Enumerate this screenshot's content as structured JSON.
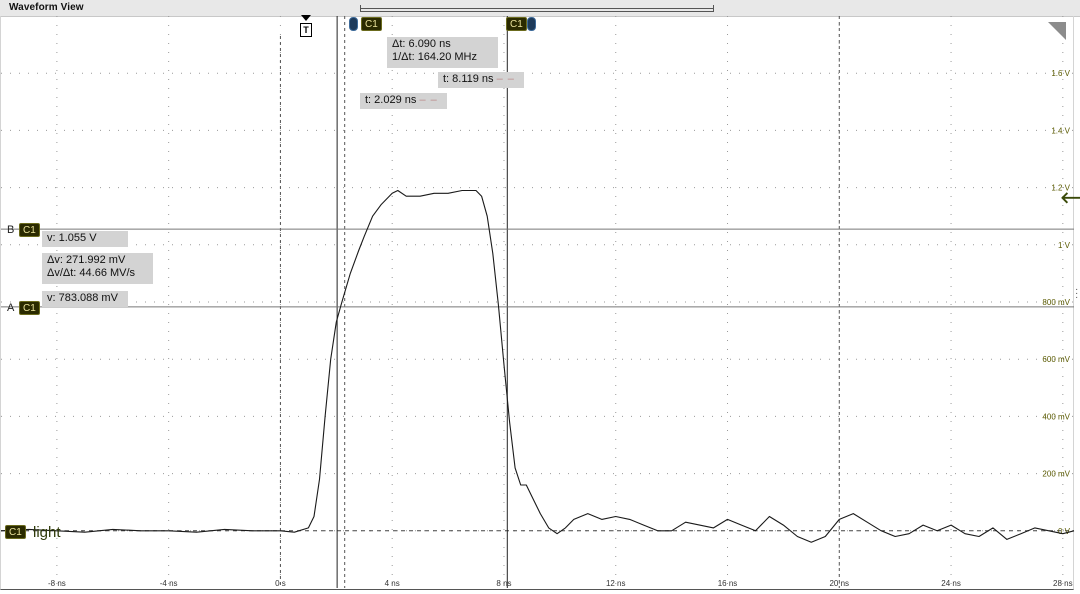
{
  "window": {
    "title": "Waveform View"
  },
  "colors": {
    "trace": "#1a1a1a",
    "grid_dot": "#9a9a9a",
    "cursor_line": "#222222",
    "axis_text": "#333333",
    "volt_text": "#5a5a00",
    "readout_bg": "#d3d3d3"
  },
  "cursors": {
    "a_label": "A",
    "b_label": "B",
    "channel_badge": "C1",
    "readouts": {
      "delta_t": "Δt: 6.090 ns",
      "inv_delta_t": "1/Δt: 164.20 MHz",
      "t_b": "t: 8.119 ns",
      "t_a": "t: 2.029 ns",
      "v_b": "v: 1.055 V",
      "delta_v": "Δv: 271.992 mV",
      "dv_dt": "Δv/Δt: 44.66 MV/s",
      "v_a": "v: 783.088 mV"
    }
  },
  "channel": {
    "badge": "C1",
    "label": "light"
  },
  "trigger": {
    "marker": "T"
  },
  "chart_data": {
    "type": "line",
    "title": "",
    "xlabel": "",
    "ylabel": "",
    "x_unit": "ns",
    "y_unit": "V",
    "xlim": [
      -10,
      28.4
    ],
    "ylim": [
      -0.2,
      1.8
    ],
    "x_ticks": [
      -8,
      -4,
      0,
      4,
      8,
      12,
      16,
      20,
      24,
      28
    ],
    "x_tick_labels": [
      "-8 ns",
      "-4 ns",
      "0 s",
      "4 ns",
      "8 ns",
      "12 ns",
      "16 ns",
      "20 ns",
      "24 ns",
      "28 ns"
    ],
    "y_ticks": [
      0,
      0.2,
      0.4,
      0.6,
      0.8,
      1.0,
      1.2,
      1.4,
      1.6
    ],
    "y_tick_labels": [
      "0 V",
      "200 mV",
      "400 mV",
      "600 mV",
      "800 mV",
      "1 V",
      "1.2 V",
      "1.4 V",
      "1.6 V"
    ],
    "grid": "dotted",
    "cursor_a": {
      "t": 2.029,
      "v": 0.783088
    },
    "cursor_b": {
      "t": 8.119,
      "v": 1.055
    },
    "series": [
      {
        "x": [
          -10,
          -9,
          -8,
          -7,
          -6,
          -5,
          -4,
          -3,
          -2,
          -1,
          0,
          0.5,
          1.0,
          1.2,
          1.4,
          1.6,
          1.8,
          2.0,
          2.2,
          2.5,
          2.8,
          3.0,
          3.3,
          3.6,
          4.0,
          4.2,
          4.5,
          5.0,
          5.5,
          6.0,
          6.5,
          7.0,
          7.2,
          7.4,
          7.6,
          7.8,
          8.0,
          8.2,
          8.4,
          8.6,
          8.8,
          9.0,
          9.3,
          9.6,
          9.9,
          10.2,
          10.5,
          11.0,
          11.5,
          12.0,
          12.5,
          13.0,
          13.5,
          14.0,
          14.5,
          15.0,
          15.5,
          16.0,
          16.5,
          17.0,
          17.5,
          18.0,
          18.5,
          19.0,
          19.5,
          20.0,
          20.5,
          21.0,
          21.5,
          22.0,
          22.5,
          23.0,
          23.5,
          24.0,
          24.5,
          25.0,
          25.5,
          26.0,
          26.5,
          27.0,
          27.5,
          28.0,
          28.4
        ],
        "y": [
          0.0,
          0.005,
          0.0,
          -0.005,
          0.005,
          0.0,
          0.0,
          -0.005,
          0.005,
          0.0,
          0.0,
          -0.005,
          0.01,
          0.05,
          0.18,
          0.4,
          0.6,
          0.73,
          0.8,
          0.9,
          0.98,
          1.03,
          1.1,
          1.14,
          1.18,
          1.19,
          1.17,
          1.17,
          1.18,
          1.18,
          1.19,
          1.19,
          1.17,
          1.1,
          0.97,
          0.79,
          0.58,
          0.38,
          0.22,
          0.16,
          0.16,
          0.12,
          0.06,
          0.01,
          -0.01,
          0.01,
          0.04,
          0.06,
          0.04,
          0.05,
          0.04,
          0.02,
          0.0,
          0.0,
          0.03,
          0.02,
          0.01,
          0.04,
          0.02,
          0.0,
          0.05,
          0.02,
          -0.02,
          -0.04,
          -0.02,
          0.04,
          0.06,
          0.03,
          0.0,
          -0.02,
          -0.01,
          0.02,
          0.0,
          0.02,
          -0.01,
          -0.02,
          0.01,
          -0.03,
          -0.01,
          0.01,
          0.0,
          -0.01,
          0.0
        ]
      }
    ]
  }
}
